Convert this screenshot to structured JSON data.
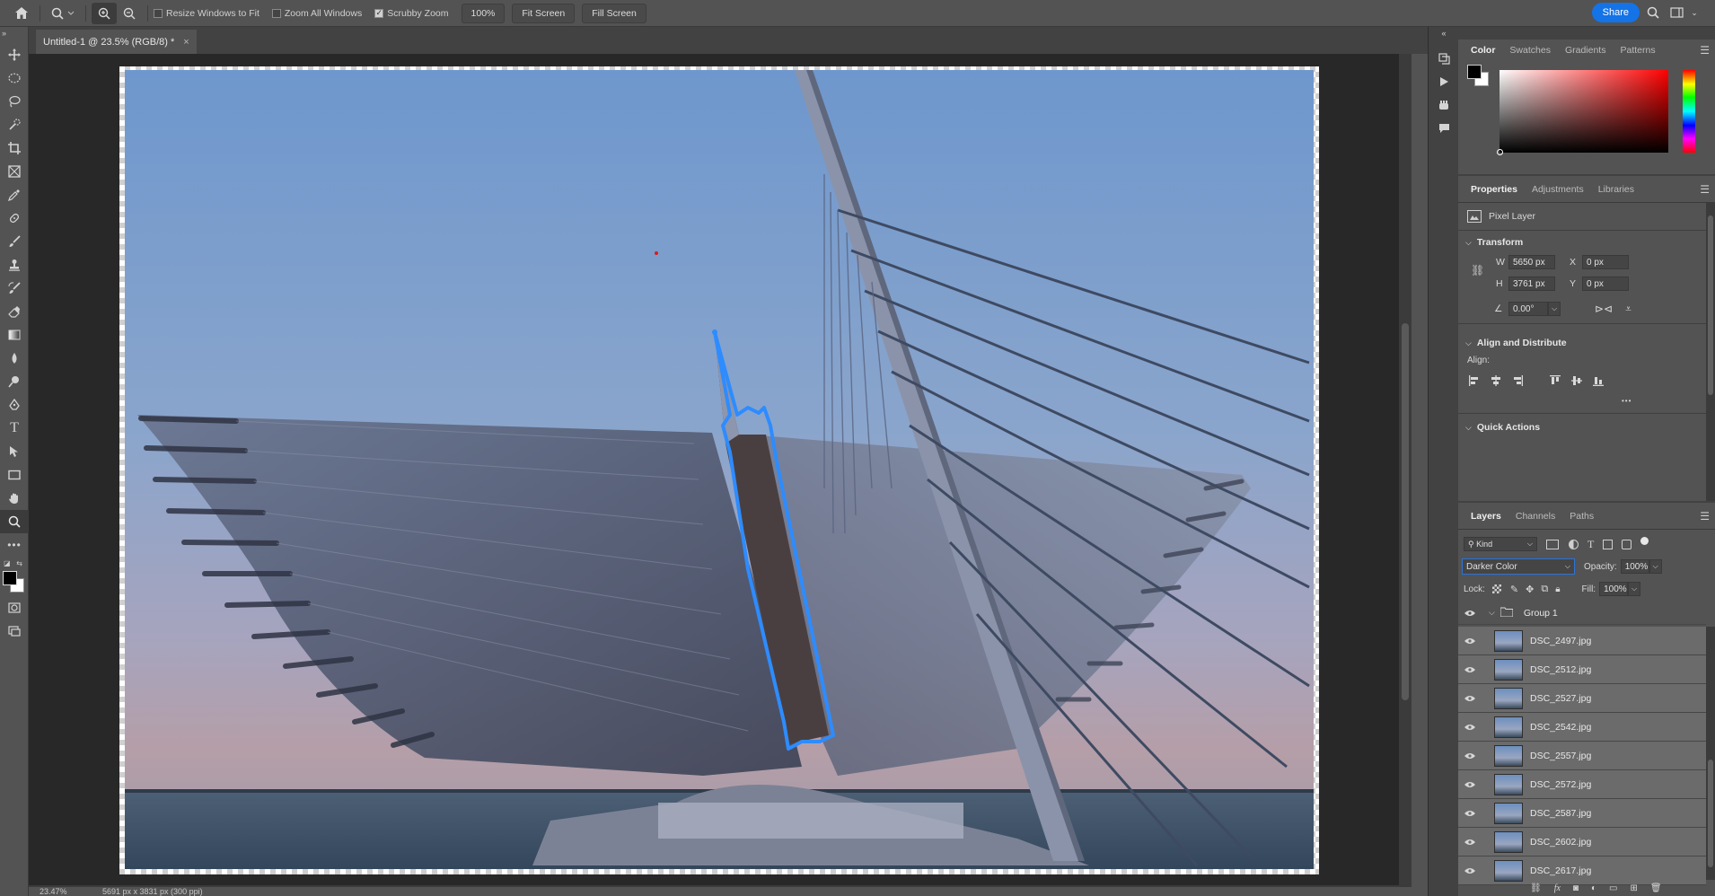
{
  "options_bar": {
    "resize_windows_label": "Resize Windows to Fit",
    "resize_windows_checked": false,
    "zoom_all_label": "Zoom All Windows",
    "zoom_all_checked": false,
    "scrubby_zoom_label": "Scrubby Zoom",
    "scrubby_zoom_checked": true,
    "zoom_100_label": "100%",
    "fit_screen_label": "Fit Screen",
    "fill_screen_label": "Fill Screen",
    "share_label": "Share"
  },
  "document": {
    "tab_title": "Untitled-1 @ 23.5% (RGB/8) *",
    "close_glyph": "×"
  },
  "status_bar": {
    "zoom": "23.47%",
    "dimensions": "5691 px x 3831 px (300 ppi)"
  },
  "color_panel": {
    "tabs": [
      "Color",
      "Swatches",
      "Gradients",
      "Patterns"
    ],
    "foreground": "#000000",
    "background": "#ffffff",
    "hue_color": "#ff0000"
  },
  "properties_panel": {
    "tabs": [
      "Properties",
      "Adjustments",
      "Libraries"
    ],
    "layer_type": "Pixel Layer",
    "transform_title": "Transform",
    "w_label": "W",
    "w_value": "5650 px",
    "h_label": "H",
    "h_value": "3761 px",
    "x_label": "X",
    "x_value": "0 px",
    "y_label": "Y",
    "y_value": "0 px",
    "angle_value": "0.00°",
    "align_title": "Align and Distribute",
    "align_label": "Align:",
    "more_glyph": "•••",
    "quick_actions_title": "Quick Actions"
  },
  "layers_panel": {
    "tabs": [
      "Layers",
      "Channels",
      "Paths"
    ],
    "filter_kind": "Kind",
    "blend_mode": "Darker Color",
    "opacity_label": "Opacity:",
    "opacity_value": "100%",
    "lock_label": "Lock:",
    "fill_label": "Fill:",
    "fill_value": "100%",
    "group_name": "Group 1",
    "layers": [
      "DSC_2497.jpg",
      "DSC_2512.jpg",
      "DSC_2527.jpg",
      "DSC_2542.jpg",
      "DSC_2557.jpg",
      "DSC_2572.jpg",
      "DSC_2587.jpg",
      "DSC_2602.jpg",
      "DSC_2617.jpg"
    ]
  },
  "colors": {
    "accent": "#1473e6",
    "selection_outline": "#2d8cff",
    "ui_bg": "#535353"
  }
}
